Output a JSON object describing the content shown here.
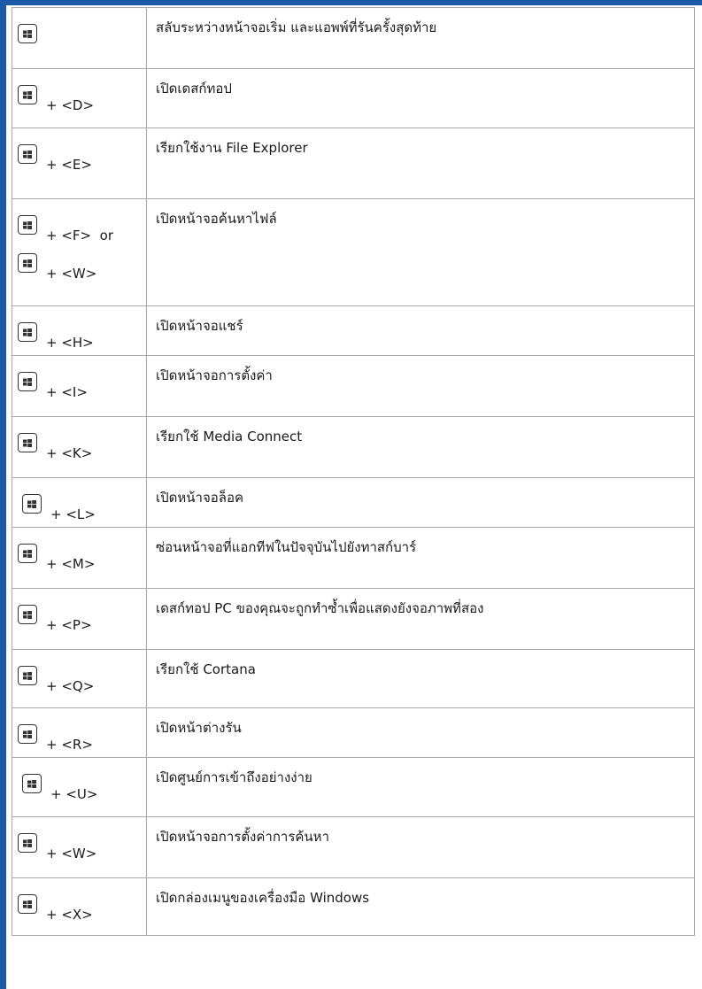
{
  "colors": {
    "accent": "#1a5aa6",
    "border": "#a8a8a8"
  },
  "rows": [
    {
      "keys": [
        ""
      ],
      "description": "สลับระหว่างหน้าจอเริ่ม และแอพพ์ที่รันครั้งสุดท้าย"
    },
    {
      "keys": [
        "+ <D>"
      ],
      "description": "เปิดเดสก์ทอป"
    },
    {
      "keys": [
        "+ <E>"
      ],
      "description": "เรียกใช้งาน File Explorer"
    },
    {
      "keys": [
        "+ <F>  or",
        "+ <W>"
      ],
      "description": "เปิดหน้าจอค้นหาไฟล์"
    },
    {
      "keys": [
        "+ <H>"
      ],
      "description": "เปิดหน้าจอแชร์"
    },
    {
      "keys": [
        "+ <I>"
      ],
      "description": "เปิดหน้าจอการตั้งค่า"
    },
    {
      "keys": [
        "+ <K>"
      ],
      "description": "เรียกใช้ Media Connect"
    },
    {
      "keys": [
        "+ <L>"
      ],
      "description": "เปิดหน้าจอล็อค"
    },
    {
      "keys": [
        "+ <M>"
      ],
      "description": "ซ่อนหน้าจอที่แอกทีฟในปัจจุบันไปยังทาสก์บาร์"
    },
    {
      "keys": [
        "+ <P>"
      ],
      "description": "เดสก์ทอป PC ของคุณจะถูกทำซ้ำเพื่อแสดงยังจอภาพที่สอง"
    },
    {
      "keys": [
        "+ <Q>"
      ],
      "description": "เรียกใช้ Cortana"
    },
    {
      "keys": [
        "+ <R>"
      ],
      "description": "เปิดหน้าต่างรัน"
    },
    {
      "keys": [
        "+ <U>"
      ],
      "description": "เปิดศูนย์การเข้าถึงอย่างง่าย"
    },
    {
      "keys": [
        "+ <W>"
      ],
      "description": "เปิดหน้าจอการตั้งค่าการค้นหา"
    },
    {
      "keys": [
        "+ <X>"
      ],
      "description": "เปิดกล่องเมนูของเครื่องมือ Windows"
    }
  ]
}
